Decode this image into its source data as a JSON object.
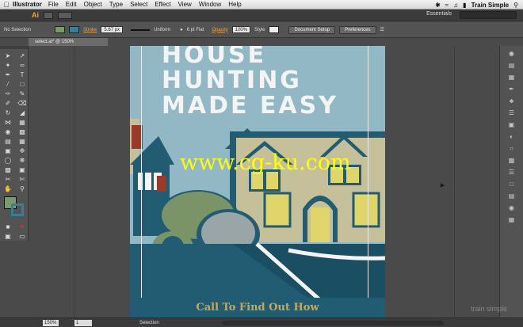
{
  "menubar": {
    "app": "Illustrator",
    "items": [
      "File",
      "Edit",
      "Object",
      "Type",
      "Select",
      "Effect",
      "View",
      "Window",
      "Help"
    ],
    "user": "Train Simple"
  },
  "appbar": {
    "logo": "Ai",
    "workspace": "Essentials"
  },
  "controlbar": {
    "selection": "No Selection",
    "stroke_label": "Stroke",
    "stroke_value": "5.67 px",
    "profile": "Uniform",
    "brush": "6 pt Flat",
    "opacity_label": "Opacity",
    "opacity_value": "100%",
    "style_label": "Style",
    "doc_setup": "Document Setup",
    "preferences": "Preferences",
    "fill_color": "#7a9a6a"
  },
  "document": {
    "tab": "select.ai* @ 150% (CMYK/Preview)"
  },
  "artwork": {
    "headline_line1": "HOUSE",
    "headline_line2": "HUNTING",
    "headline_line3": "MADE EASY",
    "cta": "Call To Find Out How",
    "watermark": "www.cg-ku.com",
    "colors": {
      "sky": "#92b8c6",
      "navy": "#215c73",
      "khaki": "#c6c09a",
      "yellow": "#dfd56a",
      "green": "#7b9467",
      "red": "#9c3a2a",
      "grey": "#9aa5a8",
      "cta": "#c7a85a"
    }
  },
  "statusbar": {
    "zoom": "150%",
    "page": "1",
    "tool": "Selection"
  },
  "brand": "train simple"
}
